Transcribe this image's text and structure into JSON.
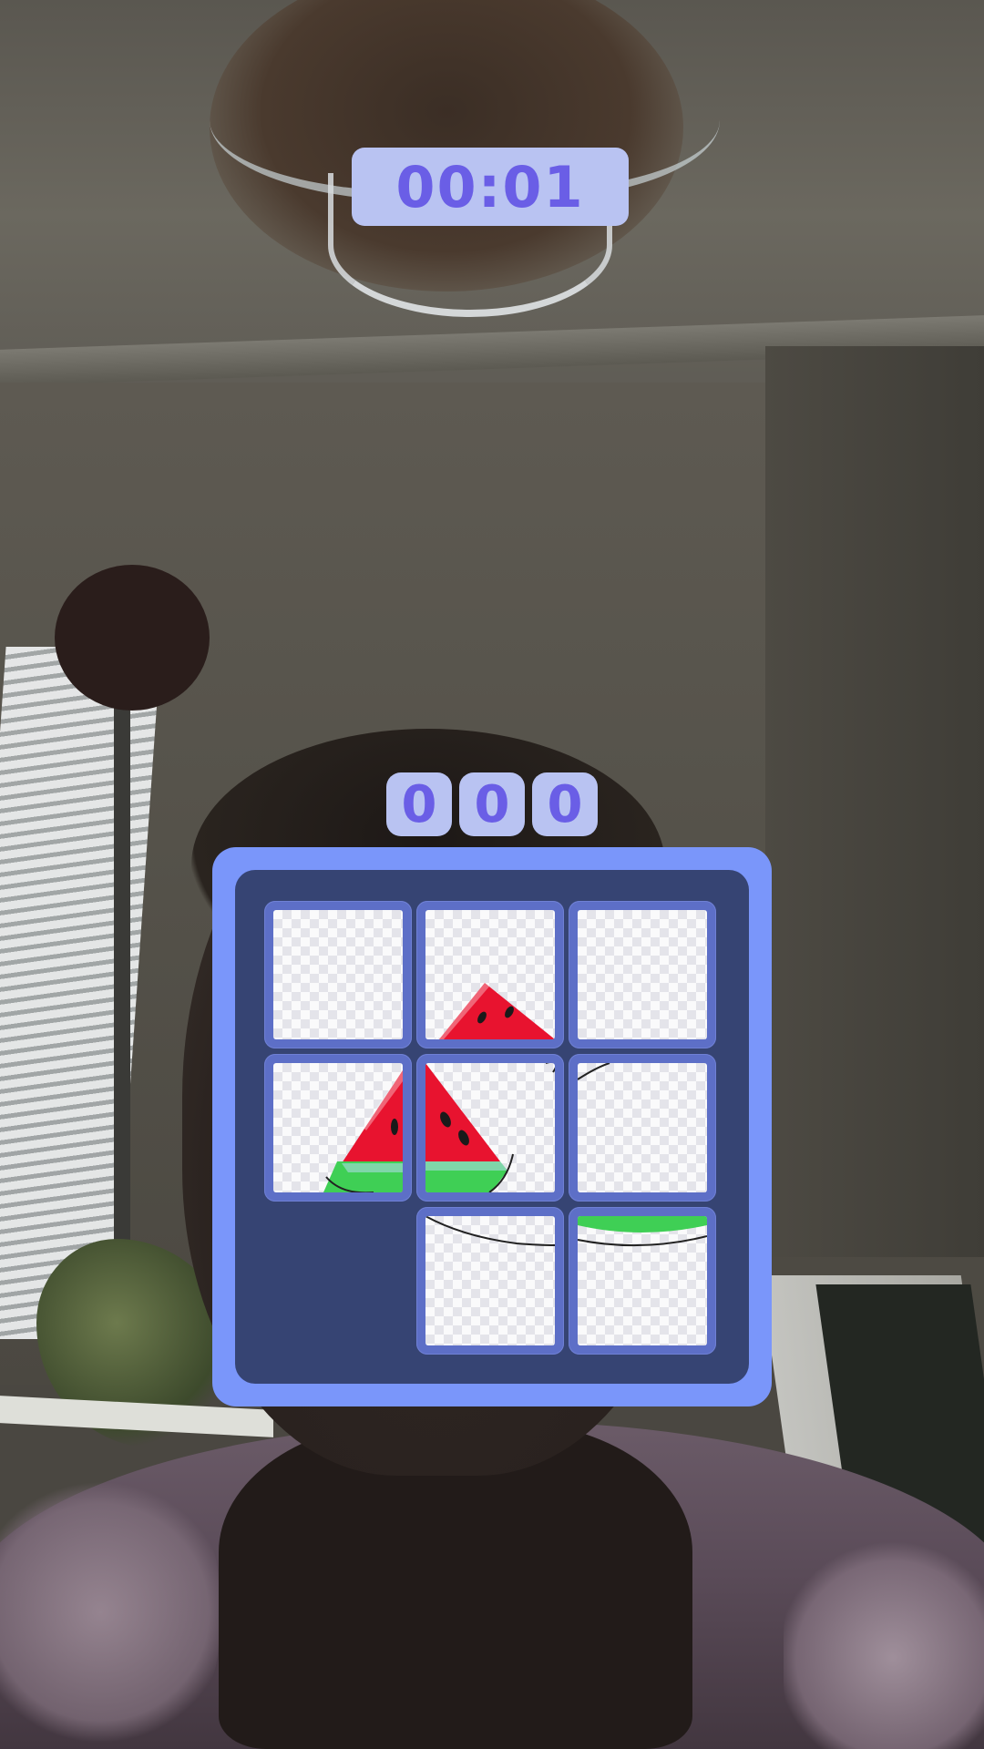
{
  "timer": {
    "text": "00:01"
  },
  "moves": {
    "digits": [
      "0",
      "0",
      "0"
    ]
  },
  "puzzle": {
    "grid_size": "3x3",
    "image_icon": "watermelon-slice-icon",
    "tiles": [
      {
        "position": 1,
        "label": "tile-1"
      },
      {
        "position": 2,
        "label": "tile-2"
      },
      {
        "position": 3,
        "label": "tile-3"
      },
      {
        "position": 4,
        "label": "tile-4"
      },
      {
        "position": 5,
        "label": "tile-5"
      },
      {
        "position": 6,
        "label": "tile-6"
      },
      {
        "position": 7,
        "label": "empty"
      },
      {
        "position": 8,
        "label": "tile-8"
      },
      {
        "position": 9,
        "label": "tile-9"
      }
    ]
  },
  "colors": {
    "board_outer": "#7a96fa",
    "board_inner": "#364473",
    "tile_frame": "#5d6fc7",
    "hud_bg": "#b9c3f2",
    "hud_text": "#6a5ee6",
    "melon_red": "#e8132f",
    "melon_green": "#3fcf55",
    "melon_light_green": "#7fd6a9"
  }
}
